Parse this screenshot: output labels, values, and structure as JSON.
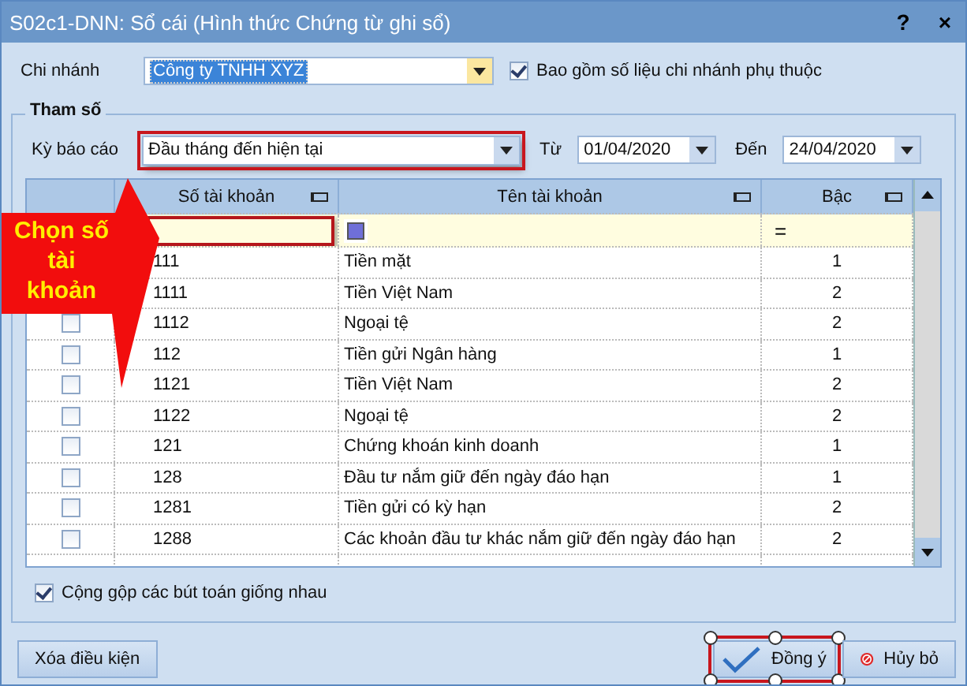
{
  "window": {
    "title": "S02c1-DNN: Sổ cái (Hình thức Chứng từ ghi sổ)",
    "help": "?",
    "close": "×"
  },
  "branch": {
    "label": "Chi nhánh",
    "value": "Công ty TNHH XYZ",
    "include_dependent": {
      "label": "Bao gồm số liệu chi nhánh phụ thuộc",
      "checked": true
    }
  },
  "params": {
    "title": "Tham số",
    "period": {
      "label": "Kỳ báo cáo",
      "value": "Đầu tháng đến hiện tại",
      "highlighted": true
    },
    "from": {
      "label": "Từ",
      "value": "01/04/2020"
    },
    "to": {
      "label": "Đến",
      "value": "24/04/2020"
    },
    "table": {
      "columns": [
        "Số tài khoản",
        "Tên tài khoản",
        "Bậc"
      ],
      "filter": {
        "account_highlighted": true,
        "level_operator": "="
      },
      "rows": [
        {
          "account": "111",
          "name": "Tiền mặt",
          "level": "1"
        },
        {
          "account": "1111",
          "name": "Tiền Việt Nam",
          "level": "2"
        },
        {
          "account": "1112",
          "name": "Ngoại tệ",
          "level": "2",
          "checked": false
        },
        {
          "account": "112",
          "name": "Tiền gửi Ngân hàng",
          "level": "1",
          "checked": false
        },
        {
          "account": "1121",
          "name": "Tiền Việt Nam",
          "level": "2",
          "checked": false
        },
        {
          "account": "1122",
          "name": "Ngoại tệ",
          "level": "2",
          "checked": false
        },
        {
          "account": "121",
          "name": "Chứng khoán kinh doanh",
          "level": "1",
          "checked": false
        },
        {
          "account": "128",
          "name": "Đầu tư nắm giữ đến ngày đáo hạn",
          "level": "1",
          "checked": false
        },
        {
          "account": "1281",
          "name": "Tiền gửi có kỳ hạn",
          "level": "2",
          "checked": false
        },
        {
          "account": "1288",
          "name": "Các khoản đầu tư khác nắm giữ đến ngày đáo hạn",
          "level": "2",
          "checked": false
        }
      ]
    },
    "merge_entries": {
      "label": "Cộng gộp các bút toán giống nhau",
      "checked": true
    }
  },
  "callout": "Chọn số tài khoản",
  "buttons": [
    {
      "kind": "clear",
      "label": "Xóa điều kiện",
      "highlighted": false
    },
    {
      "kind": "ok",
      "label": "Đồng ý",
      "highlighted": true
    },
    {
      "kind": "cancel",
      "label": "Hủy bỏ",
      "highlighted": false
    }
  ]
}
